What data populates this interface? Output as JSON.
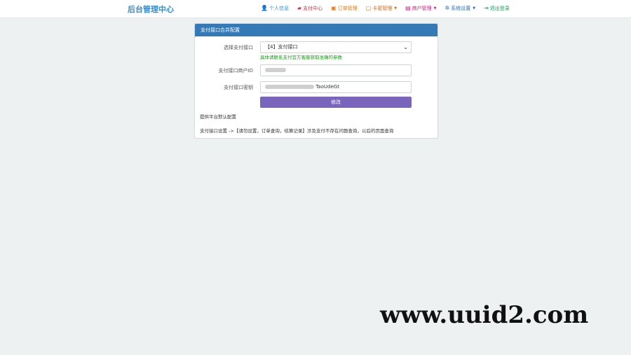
{
  "header": {
    "brand": "后台管理中心",
    "nav": [
      {
        "icon": "user-icon",
        "glyph": "👤",
        "label": "个人信息",
        "color": "#2e8fd6",
        "dropdown": false
      },
      {
        "icon": "car-icon",
        "glyph": "▰",
        "label": "支付中心",
        "color": "#d9333f",
        "dropdown": false
      },
      {
        "icon": "briefcase-icon",
        "glyph": "▣",
        "label": "订单管理",
        "color": "#e37a18",
        "dropdown": false
      },
      {
        "icon": "window-icon",
        "glyph": "▢",
        "label": "卡密管理",
        "color": "#d2691e",
        "dropdown": true
      },
      {
        "icon": "book-icon",
        "glyph": "▤",
        "label": "商户管理",
        "color": "#cc2277",
        "dropdown": true
      },
      {
        "icon": "gear-icon",
        "glyph": "✲",
        "label": "系统设置",
        "color": "#2e6fb5",
        "dropdown": true
      },
      {
        "icon": "logout-icon",
        "glyph": "⇥",
        "label": "退出登录",
        "color": "#1a9e57",
        "dropdown": false
      }
    ]
  },
  "panel": {
    "title": "支付接口合并配置",
    "fields": {
      "channel": {
        "label": "选择支付接口",
        "value": "【4】支付接口"
      },
      "hint": "具体请联系支付官方客服获取准确的参数",
      "merchant_id": {
        "label": "支付接口商户ID",
        "value": ""
      },
      "secret": {
        "label": "支付接口密钥",
        "value": "TaoUdeGt"
      }
    },
    "submit_label": "修改",
    "note1": "提供平台默认配置",
    "note2": "支付接口设置 ->【请勿设置，订单查询，结算记录】涉及支付不存在问题查询，以后的页面查询"
  },
  "watermark": "www.uuid2.com",
  "colors": {
    "accent": "#337ab7",
    "button": "#7a65bd",
    "hint": "#15a015",
    "background": "#eef1f1"
  }
}
